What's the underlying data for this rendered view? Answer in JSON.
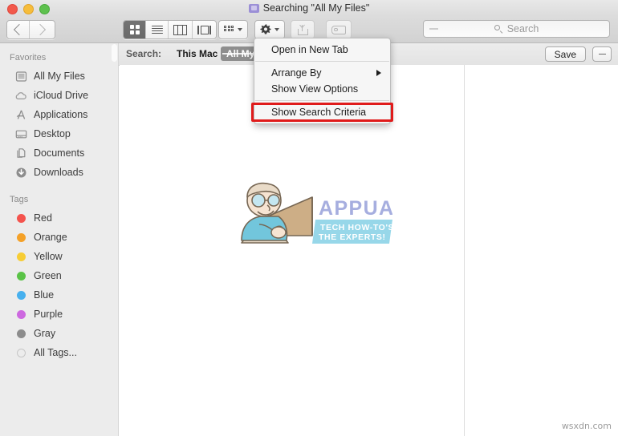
{
  "window": {
    "title": "Searching \"All My Files\"",
    "title_icon": "purple-folder-icon",
    "controls": {
      "close": "close-button",
      "minimize": "minimize-button",
      "maximize": "maximize-button"
    }
  },
  "toolbar": {
    "back_label": "Back",
    "forward_label": "Forward",
    "view_modes": [
      {
        "name": "icon-view",
        "label": "Icon View",
        "active": true
      },
      {
        "name": "list-view",
        "label": "List View",
        "active": false
      },
      {
        "name": "column-view",
        "label": "Column View",
        "active": false
      },
      {
        "name": "coverflow-view",
        "label": "Cover Flow View",
        "active": false
      }
    ],
    "arrange_label": "Arrange By",
    "action_label": "Action",
    "share_label": "Share",
    "tag_label": "Edit Tags",
    "search": {
      "placeholder": "Search",
      "value": ""
    }
  },
  "scope_bar": {
    "label": "Search:",
    "options": [
      {
        "label": "This Mac",
        "selected": false
      },
      {
        "label": "All My Files",
        "selected": true
      }
    ],
    "save_label": "Save",
    "remove_label": "−"
  },
  "sidebar": {
    "sections": [
      {
        "header": "Favorites",
        "items": [
          {
            "label": "All My Files",
            "icon": "all-my-files-icon"
          },
          {
            "label": "iCloud Drive",
            "icon": "icloud-drive-icon"
          },
          {
            "label": "Applications",
            "icon": "applications-icon"
          },
          {
            "label": "Desktop",
            "icon": "desktop-icon"
          },
          {
            "label": "Documents",
            "icon": "documents-icon"
          },
          {
            "label": "Downloads",
            "icon": "downloads-icon"
          }
        ]
      },
      {
        "header": "Tags",
        "items": [
          {
            "label": "Red",
            "icon": "tag-dot-icon",
            "color": "#f4534d"
          },
          {
            "label": "Orange",
            "icon": "tag-dot-icon",
            "color": "#f4a128"
          },
          {
            "label": "Yellow",
            "icon": "tag-dot-icon",
            "color": "#f7cd35"
          },
          {
            "label": "Green",
            "icon": "tag-dot-icon",
            "color": "#5ac347"
          },
          {
            "label": "Blue",
            "icon": "tag-dot-icon",
            "color": "#47b0ee"
          },
          {
            "label": "Purple",
            "icon": "tag-dot-icon",
            "color": "#cd69e0"
          },
          {
            "label": "Gray",
            "icon": "tag-dot-icon",
            "color": "#8c8c8c"
          },
          {
            "label": "All Tags...",
            "icon": "all-tags-icon",
            "color": "transparent"
          }
        ]
      }
    ]
  },
  "menu": {
    "items": [
      {
        "label": "Open in New Tab",
        "submenu": false,
        "highlighted": false
      },
      {
        "separator": true
      },
      {
        "label": "Arrange By",
        "submenu": true,
        "highlighted": false
      },
      {
        "label": "Show View Options",
        "submenu": false,
        "highlighted": false
      },
      {
        "separator": true
      },
      {
        "label": "Show Search Criteria",
        "submenu": false,
        "highlighted": true
      }
    ]
  },
  "content": {
    "watermark_logo": {
      "brand": "APPUALS",
      "tagline_line1": "TECH HOW-TO'S FROM",
      "tagline_line2": "THE EXPERTS!"
    },
    "corner_watermark": "wsxdn.com"
  },
  "colors": {
    "accent_red": "#e01b1b",
    "titlebar": "#e0e0e0",
    "sidebar_bg": "#ececec",
    "selection_gray": "#8e8e8e"
  }
}
